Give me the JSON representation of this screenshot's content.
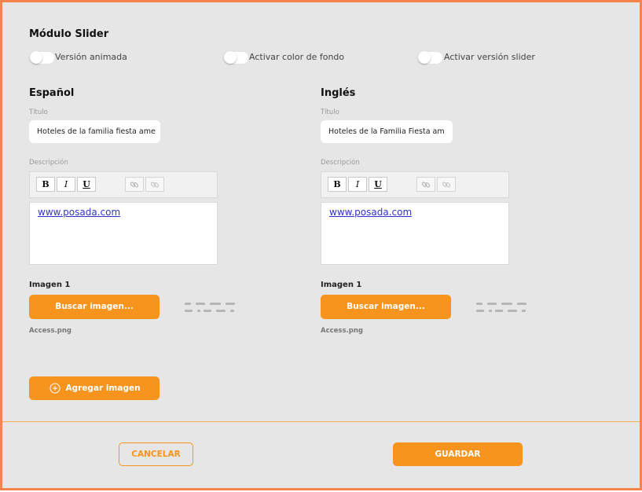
{
  "module": {
    "title": "Módulo Slider"
  },
  "toggles": [
    {
      "label": "Versión animada",
      "on": false
    },
    {
      "label": "Activar color de fondo",
      "on": false
    },
    {
      "label": "Activar versión slider",
      "on": false
    }
  ],
  "spanish": {
    "heading": "Español",
    "title_label": "Título",
    "title_value": "Hoteles de la familia fiesta ame",
    "description_label": "Descripción",
    "description_link": "www.posada.com",
    "image_label": "Imagen 1",
    "search_button": "Buscar imagen...",
    "file_name": "Access.png"
  },
  "english": {
    "heading": "Inglés",
    "title_label": "Título",
    "title_value": "Hoteles de la Familia Fiesta am",
    "description_label": "Descripción",
    "description_link": "www.posada.com",
    "image_label": "Imagen 1",
    "search_button": "Buscar imagen...",
    "file_name": "Access.png"
  },
  "toolbar": {
    "bold": "B",
    "italic": "I",
    "underline": "U"
  },
  "add_image_button": "Agregar imagen",
  "footer": {
    "cancel": "CANCELAR",
    "save": "GUARDAR"
  },
  "colors": {
    "accent": "#f7941d",
    "frame": "#f5844c",
    "background": "#e6e6e6",
    "link": "#3333cc"
  }
}
